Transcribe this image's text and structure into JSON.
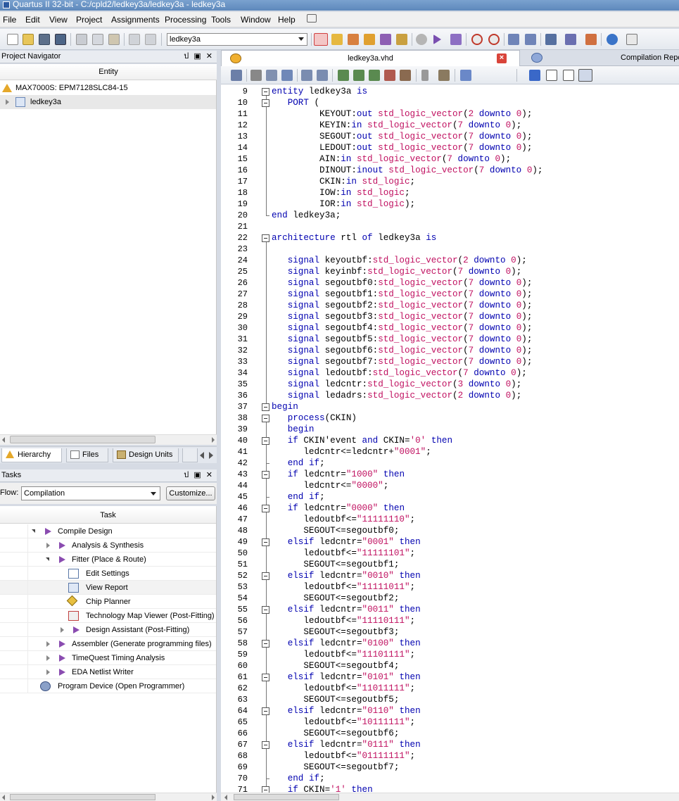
{
  "window": {
    "title": "Quartus II 32-bit - C:/cpld2/ledkey3a/ledkey3a - ledkey3a"
  },
  "menu": [
    "File",
    "Edit",
    "View",
    "Project",
    "Assignments",
    "Processing",
    "Tools",
    "Window",
    "Help"
  ],
  "toolbar": {
    "entity_value": "ledkey3a"
  },
  "project_navigator": {
    "title": "Project Navigator",
    "controls": "ป ▣ ✕",
    "column": "Entity",
    "device": "MAX7000S: EPM7128SLC84-15",
    "top_entity": "ledkey3a",
    "tabs": [
      "Hierarchy",
      "Files",
      "Design Units"
    ]
  },
  "tasks": {
    "title": "Tasks",
    "controls": "ป ▣ ✕",
    "flow_label": "Flow:",
    "flow_value": "Compilation",
    "customize_label": "Customize...",
    "column": "Task",
    "items": [
      {
        "label": "Compile Design",
        "indent": 0,
        "expander": "open",
        "icon": "play-icon"
      },
      {
        "label": "Analysis & Synthesis",
        "indent": 1,
        "expander": "closed",
        "icon": "play-icon"
      },
      {
        "label": "Fitter (Place & Route)",
        "indent": 1,
        "expander": "open",
        "icon": "play-icon"
      },
      {
        "label": "Edit Settings",
        "indent": 2,
        "expander": "none",
        "icon": "settings-window-icon"
      },
      {
        "label": "View Report",
        "indent": 2,
        "expander": "none",
        "icon": "report-table-icon"
      },
      {
        "label": "Chip Planner",
        "indent": 2,
        "expander": "none",
        "icon": "chip-planner-icon"
      },
      {
        "label": "Technology Map Viewer (Post-Fitting)",
        "indent": 2,
        "expander": "none",
        "icon": "tech-map-viewer-icon"
      },
      {
        "label": "Design Assistant (Post-Fitting)",
        "indent": 2,
        "expander": "closed",
        "icon": "play-icon"
      },
      {
        "label": "Assembler (Generate programming files)",
        "indent": 1,
        "expander": "closed",
        "icon": "play-icon"
      },
      {
        "label": "TimeQuest Timing Analysis",
        "indent": 1,
        "expander": "closed",
        "icon": "play-icon"
      },
      {
        "label": "EDA Netlist Writer",
        "indent": 1,
        "expander": "closed",
        "icon": "play-icon"
      },
      {
        "label": "Program Device (Open Programmer)",
        "indent": 0,
        "expander": "none",
        "icon": "programmer-icon"
      }
    ]
  },
  "editor": {
    "tab_label": "ledkey3a.vhd",
    "other_tab_label": "Compilation Repo",
    "line_numbers": [
      "9",
      "10",
      "11",
      "12",
      "13",
      "14",
      "15",
      "16",
      "17",
      "18",
      "19",
      "20",
      "21",
      "22",
      "23",
      "24",
      "25",
      "26",
      "27",
      "28",
      "29",
      "30",
      "31",
      "32",
      "33",
      "34",
      "35",
      "36",
      "37",
      "38",
      "39",
      "40",
      "41",
      "42",
      "43",
      "44",
      "45",
      "46",
      "47",
      "48",
      "49",
      "50",
      "51",
      "52",
      "53",
      "54",
      "55",
      "56",
      "57",
      "58",
      "59",
      "60",
      "61",
      "62",
      "63",
      "64",
      "65",
      "66",
      "67",
      "68",
      "69",
      "70",
      "71"
    ],
    "lines": [
      "entity ledkey3a is",
      "   PORT (",
      "         KEYOUT:out std_logic_vector(2 downto 0);",
      "         KEYIN:in std_logic_vector(7 downto 0);",
      "         SEGOUT:out std_logic_vector(7 downto 0);",
      "         LEDOUT:out std_logic_vector(7 downto 0);",
      "         AIN:in std_logic_vector(7 downto 0);",
      "         DINOUT:inout std_logic_vector(7 downto 0);",
      "         CKIN:in std_logic;",
      "         IOW:in std_logic;",
      "         IOR:in std_logic);",
      "end ledkey3a;",
      "",
      "architecture rtl of ledkey3a is",
      "",
      "   signal keyoutbf:std_logic_vector(2 downto 0);",
      "   signal keyinbf:std_logic_vector(7 downto 0);",
      "   signal segoutbf0:std_logic_vector(7 downto 0);",
      "   signal segoutbf1:std_logic_vector(7 downto 0);",
      "   signal segoutbf2:std_logic_vector(7 downto 0);",
      "   signal segoutbf3:std_logic_vector(7 downto 0);",
      "   signal segoutbf4:std_logic_vector(7 downto 0);",
      "   signal segoutbf5:std_logic_vector(7 downto 0);",
      "   signal segoutbf6:std_logic_vector(7 downto 0);",
      "   signal segoutbf7:std_logic_vector(7 downto 0);",
      "   signal ledoutbf:std_logic_vector(7 downto 0);",
      "   signal ledcntr:std_logic_vector(3 downto 0);",
      "   signal ledadrs:std_logic_vector(2 downto 0);",
      "begin",
      "   process(CKIN)",
      "   begin",
      "   if CKIN'event and CKIN='0' then",
      "      ledcntr<=ledcntr+\"0001\";",
      "   end if;",
      "   if ledcntr=\"1000\" then",
      "      ledcntr<=\"0000\";",
      "   end if;",
      "   if ledcntr=\"0000\" then",
      "      ledoutbf<=\"11111110\";",
      "      SEGOUT<=segoutbf0;",
      "   elsif ledcntr=\"0001\" then",
      "      ledoutbf<=\"11111101\";",
      "      SEGOUT<=segoutbf1;",
      "   elsif ledcntr=\"0010\" then",
      "      ledoutbf<=\"11111011\";",
      "      SEGOUT<=segoutbf2;",
      "   elsif ledcntr=\"0011\" then",
      "      ledoutbf<=\"11110111\";",
      "      SEGOUT<=segoutbf3;",
      "   elsif ledcntr=\"0100\" then",
      "      ledoutbf<=\"11101111\";",
      "      SEGOUT<=segoutbf4;",
      "   elsif ledcntr=\"0101\" then",
      "      ledoutbf<=\"11011111\";",
      "      SEGOUT<=segoutbf5;",
      "   elsif ledcntr=\"0110\" then",
      "      ledoutbf<=\"10111111\";",
      "      SEGOUT<=segoutbf6;",
      "   elsif ledcntr=\"0111\" then",
      "      ledoutbf<=\"01111111\";",
      "      SEGOUT<=segoutbf7;",
      "   end if;",
      "   if CKIN='1' then"
    ]
  },
  "colors": {
    "keyword": "#0000b0",
    "type": "#c01060",
    "literal": "#c01060",
    "task_play": "#8a4cb0"
  }
}
